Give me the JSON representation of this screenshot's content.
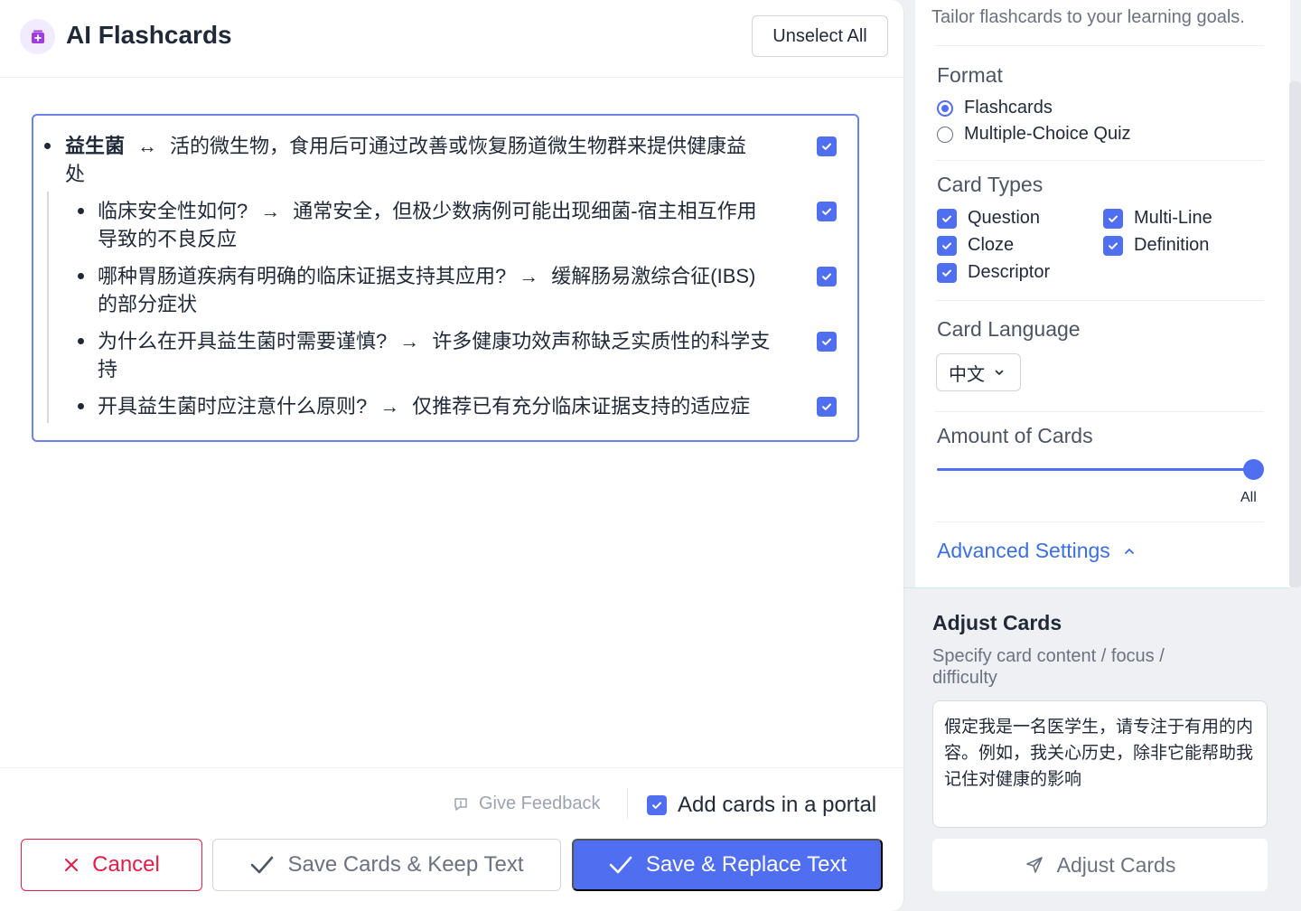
{
  "header": {
    "title": "AI Flashcards",
    "unselect_label": "Unselect All"
  },
  "cards": {
    "main": {
      "term": "益生菌",
      "arrow": "↔",
      "definition_line1": "活的微生物，食用后可通过改善或恢复肠道微生物群来提供健康益",
      "definition_line2": "处",
      "checked": true
    },
    "sub": [
      {
        "q": "临床安全性如何?",
        "arrow": "→",
        "a_line1": "通常安全，但极少数病例可能出现细菌-宿主相互作用",
        "a_line2": "导致的不良反应",
        "checked": true
      },
      {
        "q": "哪种胃肠道疾病有明确的临床证据支持其应用?",
        "arrow": "→",
        "a_line1": "缓解肠易激综合征(IBS)",
        "a_line2": "的部分症状",
        "checked": true
      },
      {
        "q": "为什么在开具益生菌时需要谨慎?",
        "arrow": "→",
        "a_line1": "许多健康功效声称缺乏实质性的科学支",
        "a_line2": "持",
        "checked": true
      },
      {
        "q": "开具益生菌时应注意什么原则?",
        "arrow": "→",
        "a_line1": "仅推荐已有充分临床证据支持的适应症",
        "a_line2": "",
        "checked": true
      }
    ]
  },
  "footer": {
    "feedback_label": "Give Feedback",
    "portal_label": "Add cards in a portal",
    "portal_checked": true,
    "cancel_label": "Cancel",
    "keep_label": "Save Cards & Keep Text",
    "replace_label": "Save & Replace Text"
  },
  "settings": {
    "tailor_text": "Tailor flashcards to your learning goals.",
    "format_title": "Format",
    "format_options": [
      {
        "label": "Flashcards",
        "selected": true
      },
      {
        "label": "Multiple-Choice Quiz",
        "selected": false
      }
    ],
    "card_types_title": "Card Types",
    "card_types": [
      {
        "label": "Question",
        "checked": true
      },
      {
        "label": "Multi-Line",
        "checked": true
      },
      {
        "label": "Cloze",
        "checked": true
      },
      {
        "label": "Definition",
        "checked": true
      },
      {
        "label": "Descriptor",
        "checked": true
      }
    ],
    "language_title": "Card Language",
    "language_value": "中文",
    "amount_title": "Amount of Cards",
    "amount_value": "All",
    "amount_fraction": 1.0,
    "advanced_label": "Advanced Settings"
  },
  "adjust": {
    "title": "Adjust Cards",
    "subtitle": "Specify card content / focus / difficulty",
    "instructions": "假定我是一名医学生，请专注于有用的内容。例如，我关心历史，除非它能帮助我记住对健康的影响",
    "button_label": "Adjust Cards"
  },
  "colors": {
    "accent": "#4f6ef0",
    "danger": "#e11d48",
    "link": "#3b6fe0"
  }
}
